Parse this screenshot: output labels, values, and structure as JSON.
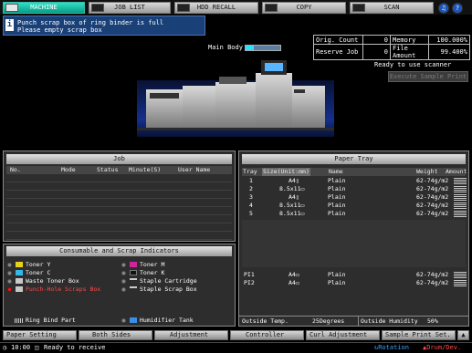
{
  "tabs": [
    {
      "label": "MACHINE",
      "active": true
    },
    {
      "label": "JOB LIST",
      "active": false
    },
    {
      "label": "HDD RECALL",
      "active": false
    },
    {
      "label": "COPY",
      "active": false
    },
    {
      "label": "SCAN",
      "active": false
    }
  ],
  "message": {
    "line1": "Punch scrap box of ring binder is full",
    "line2": "Please empty scrap box"
  },
  "status": {
    "orig_count_label": "Orig. Count",
    "orig_count_value": "0",
    "memory_label": "Memory",
    "memory_value": "100.000%",
    "reserve_job_label": "Reserve Job",
    "reserve_job_value": "0",
    "file_amount_label": "File Amount",
    "file_amount_value": "99.400%",
    "main_body_label": "Main Body",
    "scanner_status": "Ready to use scanner",
    "execute_sample_print": "Execute Sample Print"
  },
  "job_panel": {
    "title": "Job",
    "columns": [
      "No.",
      "Mode",
      "Status",
      "Minute(S)",
      "User Name"
    ]
  },
  "consumables": {
    "title": "Consumable and Scrap Indicators",
    "left": [
      {
        "label": "Toner Y",
        "alert": false
      },
      {
        "label": "Toner C",
        "alert": false
      },
      {
        "label": "Waste Toner Box",
        "alert": false
      },
      {
        "label": "Punch-Hole Scraps Box",
        "alert": true
      }
    ],
    "right": [
      {
        "label": "Toner M",
        "alert": false
      },
      {
        "label": "Toner K",
        "alert": false
      },
      {
        "label": "Staple Cartridge",
        "alert": false
      },
      {
        "label": "Staple Scrap Box",
        "alert": false
      }
    ],
    "ring_bind": "Ring Bind Part",
    "humidifier": "Humidifier Tank"
  },
  "paper_tray": {
    "title": "Paper Tray",
    "columns": [
      "Tray",
      "Size(Unit:mm)",
      "Name",
      "Weight",
      "Amount"
    ],
    "trays": [
      {
        "tray": "1",
        "size": "A4▯",
        "name": "Plain",
        "weight": "62-74g/m2"
      },
      {
        "tray": "2",
        "size": "8.5x11▭",
        "name": "Plain",
        "weight": "62-74g/m2"
      },
      {
        "tray": "3",
        "size": "A4▯",
        "name": "Plain",
        "weight": "62-74g/m2"
      },
      {
        "tray": "4",
        "size": "8.5x11▭",
        "name": "Plain",
        "weight": "62-74g/m2"
      },
      {
        "tray": "5",
        "size": "8.5x11▭",
        "name": "Plain",
        "weight": "62-74g/m2"
      }
    ],
    "inserters": [
      {
        "tray": "PI1",
        "size": "A4▭",
        "name": "Plain",
        "weight": "62-74g/m2"
      },
      {
        "tray": "PI2",
        "size": "A4▭",
        "name": "Plain",
        "weight": "62-74g/m2"
      }
    ],
    "outside_temp_label": "Outside Temp.",
    "outside_temp_value": "25Degrees",
    "outside_humidity_label": "Outside Humidity",
    "outside_humidity_value": "50%"
  },
  "bottom_buttons": [
    "Paper Setting",
    "Both Sides",
    "Adjustment",
    "Controller",
    "Curl Adjustment",
    "Sample Print Set."
  ],
  "footer": {
    "time": "10:00",
    "status": "Ready to receive",
    "rotation": "Rotation",
    "drum_dev": "Drum/Dev."
  },
  "colors": {
    "active_tab": "#12b39d",
    "alert": "#e02020",
    "message_bg": "#1a4078"
  }
}
